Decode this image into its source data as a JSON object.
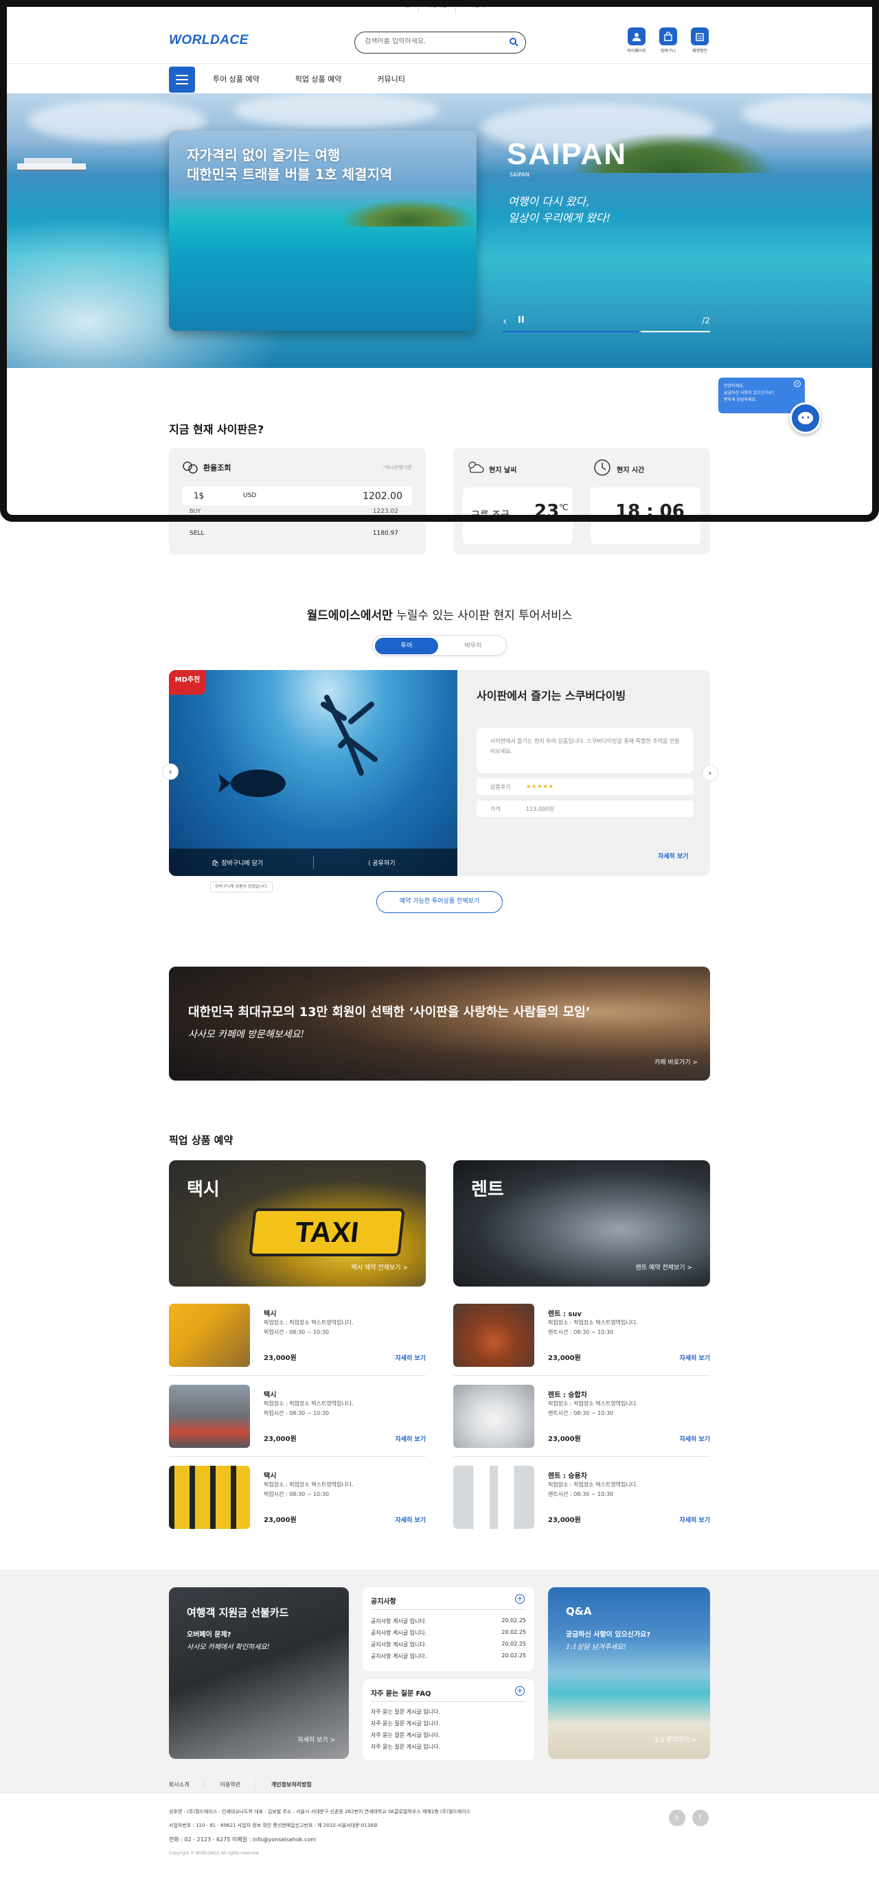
{
  "topbar": {
    "links": [
      "로그인",
      "회원가입",
      "고객센터"
    ]
  },
  "header": {
    "logo": "WORLDACE",
    "search_placeholder": "검색어를 입력하세요.",
    "icons": [
      {
        "label": "마이페이지",
        "icon": "user-icon"
      },
      {
        "label": "장바구니",
        "icon": "bag-icon"
      },
      {
        "label": "예약확인",
        "icon": "calendar-icon"
      }
    ]
  },
  "nav": {
    "items": [
      "투어 상품 예약",
      "픽업 상품 예약",
      "커뮤니티"
    ]
  },
  "hero": {
    "card_title_1": "자가격리 없이 즐기는 여행",
    "card_title_2": "대한민국 트래블 버블 1호 체결지역",
    "place": "SAIPAN",
    "place_sub": "SAIPAN",
    "script_1": "여행이 다시 왔다,",
    "script_2": "일상이 우리에게 왔다!",
    "slide_num": "/2",
    "progress": 0.66
  },
  "chat": {
    "line1": "안녕하세요,",
    "line2": "궁금하신 사항이 있으신가요?",
    "line3": "편하게 상담하세요."
  },
  "now": {
    "title": "지금 현재 사이판은?",
    "exchange_label": "환율조회",
    "exchange_note": "*하나은행기준",
    "unit": "1$",
    "currency": "USD",
    "rate": "1202.00",
    "buy_label": "BUY",
    "buy_value": "1223.02",
    "sell_label": "SELL",
    "sell_value": "1180.97",
    "weather_label": "현지 날씨",
    "weather_text": "구름 조금",
    "temp": "23",
    "temp_unit": "℃",
    "time_label": "현지 시간",
    "time": "18 : 06"
  },
  "tour": {
    "heading_bold": "월드에이스에서만",
    "heading_rest": " 누릴수 있는 사이판 현지 투어서비스",
    "tabs": [
      "투어",
      "바우처"
    ],
    "badge": "MD추천",
    "cart": "장바구니에 담기",
    "share": "공유하기",
    "tooltip": "장바구니에 상품이 담겼습니다.",
    "title": "사이판에서 즐기는 스쿠버다이빙",
    "desc": "사이판에서 즐기는 현지 투어 상품입니다. 스쿠버다이빙을 통해 특별한 추억을 만들어보세요.",
    "review_label": "상품후기",
    "stars": "★★★★★",
    "price_label": "가격",
    "price": "123,000원",
    "more": "자세히 보기",
    "all_button": "예약 가능한 투어상품 전체보기"
  },
  "cafe": {
    "title": "대한민국 최대규모의 13만 회원이 선택한 ‘사이판을 사랑하는 사람들의 모임’",
    "sub": "사사모 카페에 방문해보세요!",
    "link": "카페 바로가기 >"
  },
  "pickup": {
    "title": "픽업 상품 예약",
    "taxi": {
      "title": "택시",
      "link": "택시 예약 전체보기 >"
    },
    "rent": {
      "title": "렌트",
      "link": "렌트 예약 전체보기 >"
    },
    "taxi_items": [
      {
        "name": "택시",
        "place": "픽업장소 : 픽업장소 텍스트영역입니다.",
        "time": "픽업시간 : 08:30 ~ 10:30",
        "price": "23,000원",
        "more": "자세히 보기"
      },
      {
        "name": "택시",
        "place": "픽업장소 : 픽업장소 텍스트영역입니다.",
        "time": "픽업시간 : 08:30 ~ 10:30",
        "price": "23,000원",
        "more": "자세히 보기"
      },
      {
        "name": "택시",
        "place": "픽업장소 : 픽업장소 텍스트영역입니다.",
        "time": "픽업시간 : 08:30 ~ 10:30",
        "price": "23,000원",
        "more": "자세히 보기"
      }
    ],
    "rent_items": [
      {
        "name": "렌트 : suv",
        "place": "픽업장소 : 픽업장소 텍스트영역입니다.",
        "time": "렌트시간 : 08:30 ~ 10:30",
        "price": "23,000원",
        "more": "자세히 보기"
      },
      {
        "name": "렌트 : 승합차",
        "place": "픽업장소 : 픽업장소 텍스트영역입니다.",
        "time": "렌트시간 : 08:30 ~ 10:30",
        "price": "23,000원",
        "more": "자세히 보기"
      },
      {
        "name": "렌트 : 승용차",
        "place": "픽업장소 : 픽업장소 텍스트영역입니다.",
        "time": "렌트시간 : 08:30 ~ 10:30",
        "price": "23,000원",
        "more": "자세히 보기"
      }
    ]
  },
  "card": {
    "title": "여행객 지원금 선불카드",
    "q": "오버페이 문제?",
    "s": "사사모 카페에서 확인하세요!",
    "link": "자세히 보기 >"
  },
  "notice": {
    "title": "공지사항",
    "items": [
      {
        "t": "공지사항 게시글 입니다.",
        "d": "20.02.25"
      },
      {
        "t": "공지사항 게시글 입니다.",
        "d": "20.02.25"
      },
      {
        "t": "공지사항 게시글 입니다.",
        "d": "20.02.25"
      },
      {
        "t": "공지사항 게시글 입니다.",
        "d": "20.02.25"
      }
    ]
  },
  "faq": {
    "title": "자주 묻는 질문 FAQ",
    "items": [
      "자주 묻는 질문 게시글 입니다.",
      "자주 묻는 질문 게시글 입니다.",
      "자주 묻는 질문 게시글 입니다.",
      "자주 묻는 질문 게시글 입니다."
    ]
  },
  "qna": {
    "title": "Q&A",
    "q": "궁금하신 사항이 있으신가요?",
    "s": "1:1상담 남겨주세요!",
    "link": "1:1 문의하기 >"
  },
  "footer": {
    "links": [
      "회사소개",
      "이용약관",
      "개인정보처리방침"
    ],
    "line1": "상호명 : (주)월드에이스 · 인세대교나도착   대표 : 김보철   주소 : 서울시 서대문구 신촌동 262번지 연세대학교 SK글로벌하우스 제제2층 (주)월드에이스",
    "line2": "사업자번호 : 110 - 81 - 69621   사업자 정보 확인   통신판매업신고번호 : 제 2010-서울서대문-0138호",
    "line3": "전화 : 02 - 2123 - 6275        이메일 : info@yonseisahok.com",
    "copy": "Copyright © WORLDACE All rights reserved."
  },
  "colors": {
    "primary": "#1d63c9",
    "badge": "#d9262a"
  }
}
